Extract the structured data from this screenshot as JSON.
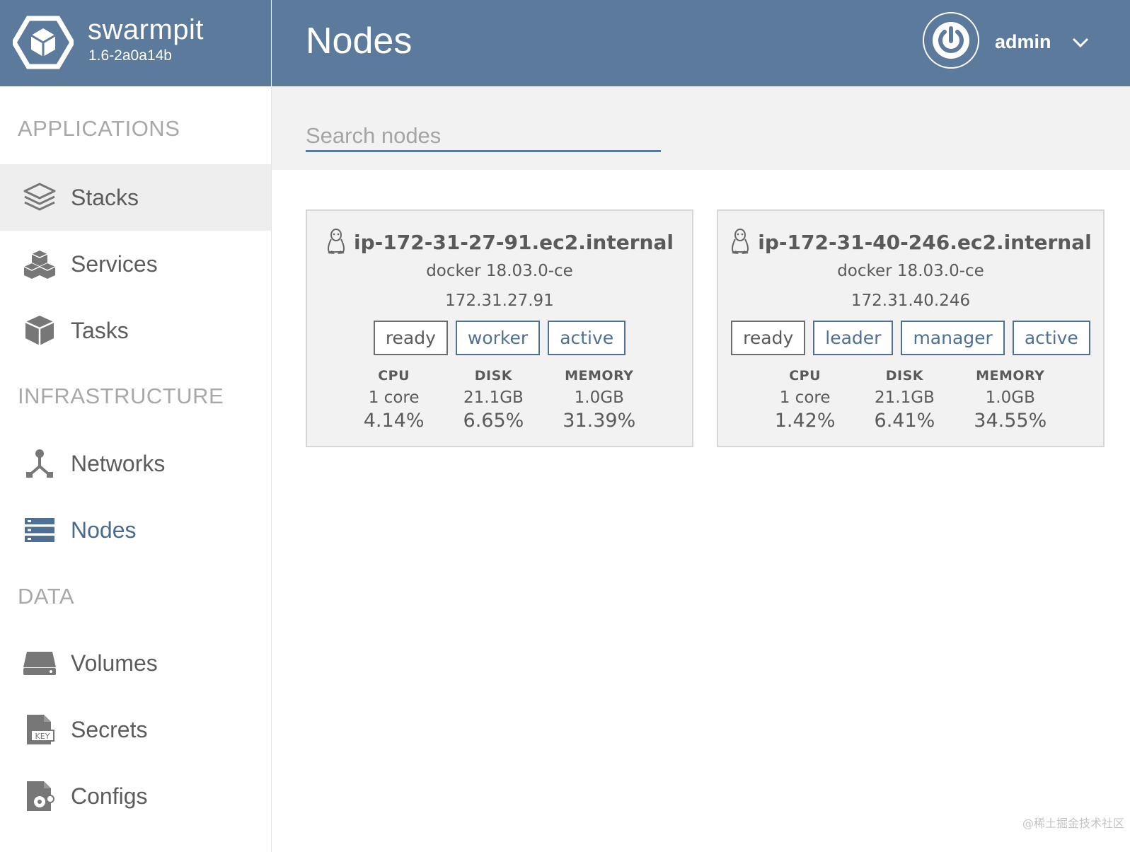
{
  "brand": {
    "name": "swarmpit",
    "version": "1.6-2a0a14b"
  },
  "header": {
    "title": "Nodes",
    "username": "admin"
  },
  "search": {
    "placeholder": "Search nodes"
  },
  "sidebar": {
    "sections": [
      {
        "title": "APPLICATIONS",
        "items": [
          {
            "label": "Stacks",
            "icon": "layers-icon"
          },
          {
            "label": "Services",
            "icon": "cubes-icon"
          },
          {
            "label": "Tasks",
            "icon": "cube-icon"
          }
        ]
      },
      {
        "title": "INFRASTRUCTURE",
        "items": [
          {
            "label": "Networks",
            "icon": "network-icon"
          },
          {
            "label": "Nodes",
            "icon": "server-icon",
            "selected": true
          }
        ]
      },
      {
        "title": "DATA",
        "items": [
          {
            "label": "Volumes",
            "icon": "drive-icon"
          },
          {
            "label": "Secrets",
            "icon": "key-file-icon"
          },
          {
            "label": "Configs",
            "icon": "settings-file-icon"
          }
        ]
      }
    ]
  },
  "nodes": [
    {
      "name": "ip-172-31-27-91.ec2.internal",
      "engine": "docker 18.03.0-ce",
      "ip": "172.31.27.91",
      "state": "ready",
      "role": "worker",
      "availability": "active",
      "resources": {
        "cpu": {
          "label": "CPU",
          "capacity": "1 core",
          "usage": "4.14%"
        },
        "disk": {
          "label": "DISK",
          "capacity": "21.1GB",
          "usage": "6.65%"
        },
        "memory": {
          "label": "MEMORY",
          "capacity": "1.0GB",
          "usage": "31.39%"
        }
      }
    },
    {
      "name": "ip-172-31-40-246.ec2.internal",
      "engine": "docker 18.03.0-ce",
      "ip": "172.31.40.246",
      "state": "ready",
      "leader": "leader",
      "role": "manager",
      "availability": "active",
      "resources": {
        "cpu": {
          "label": "CPU",
          "capacity": "1 core",
          "usage": "1.42%"
        },
        "disk": {
          "label": "DISK",
          "capacity": "21.1GB",
          "usage": "6.41%"
        },
        "memory": {
          "label": "MEMORY",
          "capacity": "1.0GB",
          "usage": "34.55%"
        }
      }
    }
  ],
  "watermark": "@稀土掘金技术社区",
  "colors": {
    "primary": "#5b7a9c",
    "selected": "#4a6a8e",
    "hover": "#eeeeee",
    "panel": "#f2f2f2"
  }
}
